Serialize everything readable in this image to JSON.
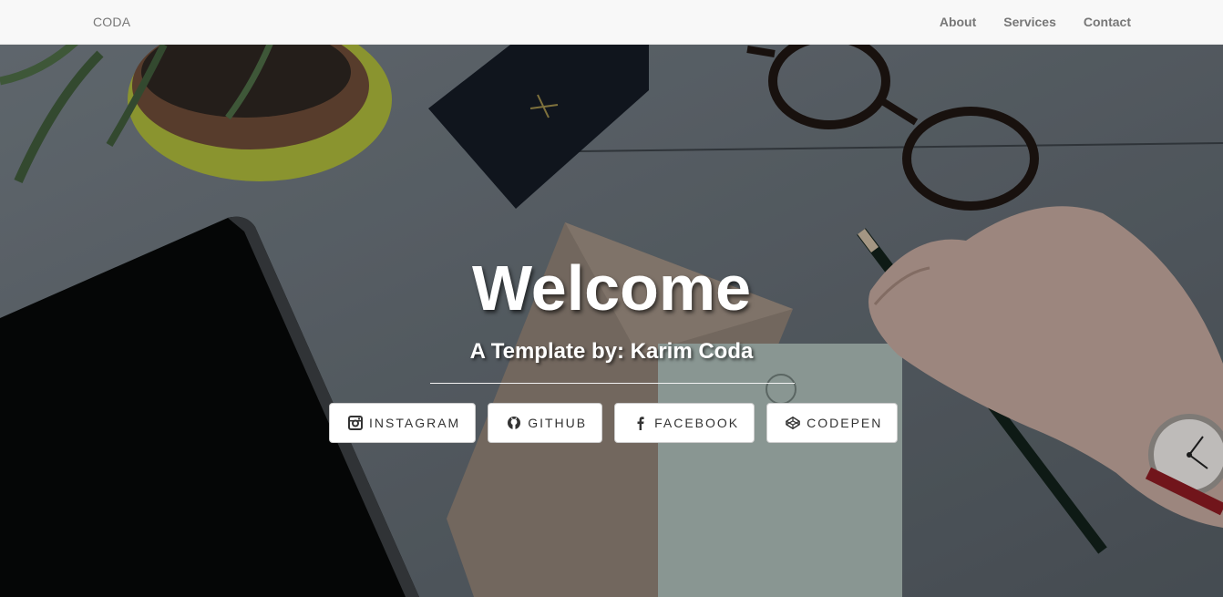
{
  "navbar": {
    "brand": "CODA",
    "links": [
      {
        "label": "About"
      },
      {
        "label": "Services"
      },
      {
        "label": "Contact"
      }
    ]
  },
  "hero": {
    "title": "Welcome",
    "subtitle": "A Template by: Karim Coda",
    "buttons": [
      {
        "label": "INSTAGRAM",
        "icon": "instagram-icon"
      },
      {
        "label": "GITHUB",
        "icon": "github-icon"
      },
      {
        "label": "FACEBOOK",
        "icon": "facebook-icon"
      },
      {
        "label": "CODEPEN",
        "icon": "codepen-icon"
      }
    ]
  },
  "colors": {
    "navbar_bg": "#f8f8f8",
    "nav_text": "#777777",
    "hero_text": "#ffffff",
    "button_bg": "#ffffff"
  }
}
